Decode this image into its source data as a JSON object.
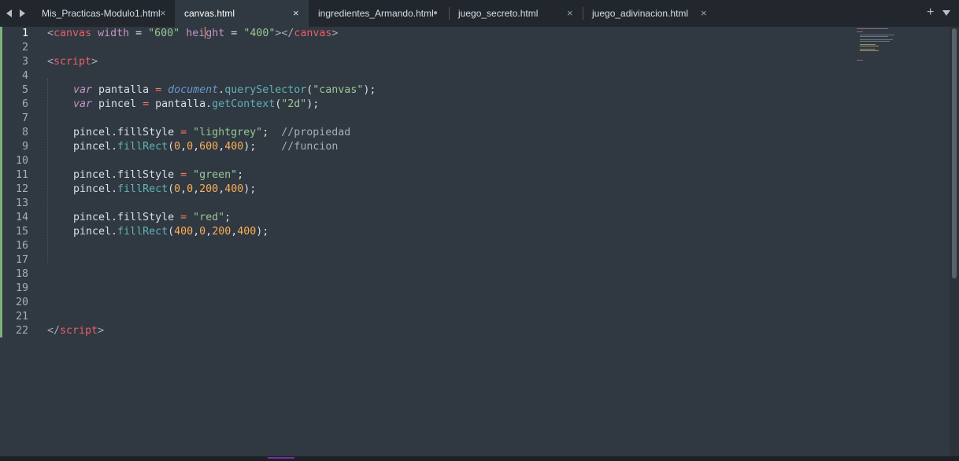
{
  "tabs": [
    {
      "label": "Mis_Practicas-Modulo1.html",
      "active": false,
      "indicator": "×"
    },
    {
      "label": "canvas.html",
      "active": true,
      "indicator": "×"
    },
    {
      "label": "ingredientes_Armando.html",
      "active": false,
      "indicator": "●"
    },
    {
      "label": "juego_secreto.html",
      "active": false,
      "indicator": "×"
    },
    {
      "label": "juego_adivinacion.html",
      "active": false,
      "indicator": "×"
    }
  ],
  "toolbar": {
    "new_tab_label": "+"
  },
  "icons": {
    "back": "arrow-left-icon",
    "forward": "arrow-right-icon",
    "new_tab": "plus-icon",
    "tabs_menu": "chevron-down-icon"
  },
  "editor": {
    "current_line": 1,
    "line_numbers": [
      "1",
      "2",
      "3",
      "4",
      "5",
      "6",
      "7",
      "8",
      "9",
      "10",
      "11",
      "12",
      "13",
      "14",
      "15",
      "16",
      "17",
      "18",
      "19",
      "20",
      "21",
      "22"
    ],
    "lines": {
      "l1": [
        "<",
        "canvas",
        " ",
        "width",
        " ",
        "=",
        " ",
        "\"600\"",
        " ",
        "hei",
        "ght",
        " ",
        "=",
        " ",
        "\"400\"",
        "></",
        "canvas",
        ">"
      ],
      "l3": [
        "<",
        "script",
        ">"
      ],
      "l5": [
        "var",
        " pantalla ",
        "=",
        " ",
        "document",
        ".",
        "querySelector",
        "(",
        "\"canvas\"",
        ");"
      ],
      "l6": [
        "var",
        " pincel ",
        "=",
        " pantalla.",
        "getContext",
        "(",
        "\"2d\"",
        ");"
      ],
      "l8": [
        "pincel.fillStyle ",
        "=",
        " ",
        "\"lightgrey\"",
        ";  ",
        "//propiedad"
      ],
      "l9": [
        "pincel.",
        "fillRect",
        "(",
        "0",
        ",",
        "0",
        ",",
        "600",
        ",",
        "400",
        ");    ",
        "//funcion"
      ],
      "l11": [
        "pincel.fillStyle ",
        "=",
        " ",
        "\"green\"",
        ";"
      ],
      "l12": [
        "pincel.",
        "fillRect",
        "(",
        "0",
        ",",
        "0",
        ",",
        "200",
        ",",
        "400",
        ");"
      ],
      "l14": [
        "pincel.fillStyle ",
        "=",
        " ",
        "\"red\"",
        ";"
      ],
      "l15": [
        "pincel.",
        "fillRect",
        "(",
        "400",
        ",",
        "0",
        ",",
        "200",
        ",",
        "400",
        ");"
      ],
      "l22": [
        "</",
        "script",
        ">"
      ]
    }
  },
  "colors": {
    "background": "#303841",
    "tabbar": "#21272d",
    "tag": "#ec5f67",
    "attribute": "#c594c5",
    "string": "#99c794",
    "number": "#f9ae58",
    "function": "#5fb3b3",
    "object": "#6699cc",
    "operator": "#f97b58"
  }
}
